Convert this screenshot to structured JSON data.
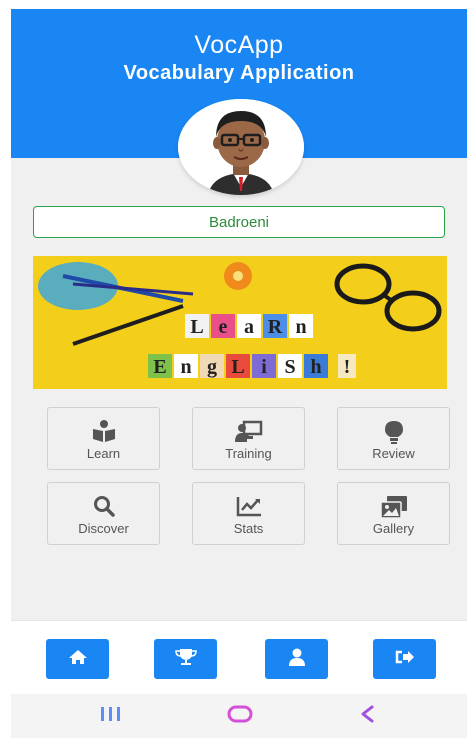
{
  "header": {
    "title": "VocApp",
    "subtitle": "Vocabulary Application"
  },
  "profile": {
    "name": "Badroeni"
  },
  "banner": {
    "text_line1": "LeaRn",
    "text_line2": "EngLiSh",
    "exclaim": "!"
  },
  "menu": [
    {
      "label": "Learn",
      "icon": "book-reader-icon"
    },
    {
      "label": "Training",
      "icon": "chalkboard-teacher-icon"
    },
    {
      "label": "Review",
      "icon": "lightbulb-icon"
    },
    {
      "label": "Discover",
      "icon": "search-icon"
    },
    {
      "label": "Stats",
      "icon": "chart-line-icon"
    },
    {
      "label": "Gallery",
      "icon": "images-icon"
    }
  ],
  "bottom_nav": [
    {
      "icon": "home-icon"
    },
    {
      "icon": "trophy-icon"
    },
    {
      "icon": "user-icon"
    },
    {
      "icon": "sign-out-icon"
    }
  ],
  "system_nav": [
    {
      "icon": "recents-icon"
    },
    {
      "icon": "home-pill-icon"
    },
    {
      "icon": "back-icon"
    }
  ],
  "colors": {
    "primary": "#1a86f3",
    "name_border": "#2aa54a",
    "banner_bg": "#f3cf1b",
    "system_recents": "#5b8ff5",
    "system_home": "#d64fd8",
    "system_back": "#a24fe0"
  }
}
